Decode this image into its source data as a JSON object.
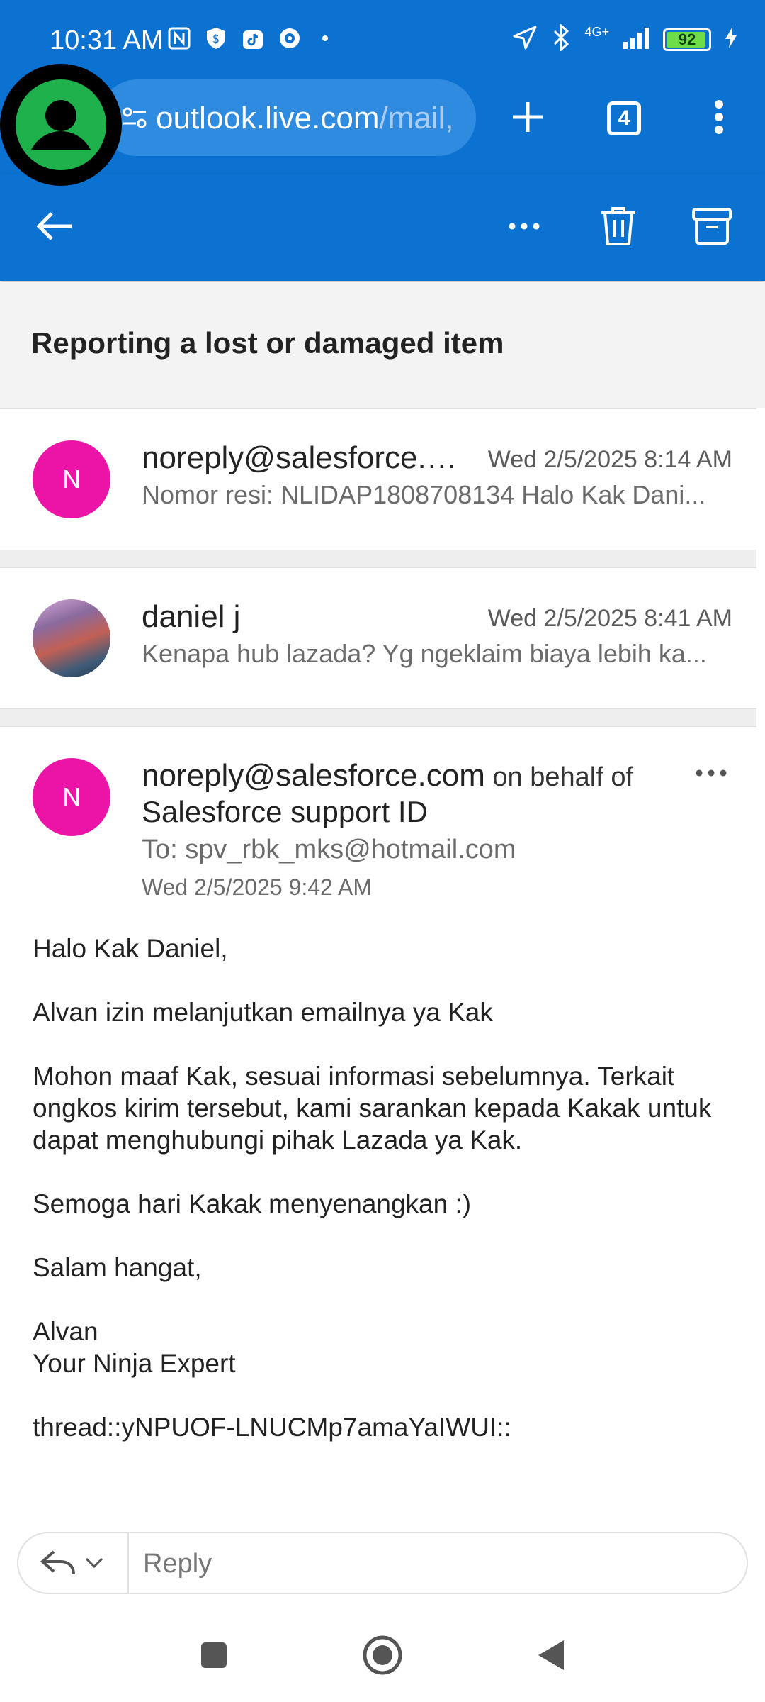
{
  "status_bar": {
    "time": "10:31 AM",
    "network": "4G+",
    "battery": "92",
    "icons": [
      "nfc-icon",
      "shield-dollar-icon",
      "tiktok-icon",
      "circle-app-icon",
      "location-arrow-icon",
      "bluetooth-icon",
      "signal-icon",
      "charging-bolt-icon"
    ]
  },
  "browser": {
    "url_host": "outlook.live.com",
    "url_path": "/mail,",
    "tab_count": "4",
    "icons": [
      "site-settings-icon",
      "new-tab-plus-icon",
      "tab-switcher-icon",
      "browser-menu-icon"
    ]
  },
  "app_bar": {
    "icons": [
      "back-arrow-icon",
      "more-horizontal-icon",
      "delete-trash-icon",
      "archive-icon"
    ]
  },
  "thread": {
    "subject": "Reporting a lost or damaged item",
    "messages": [
      {
        "initial": "N",
        "sender": "noreply@salesforce.c...",
        "date": "Wed 2/5/2025 8:14 AM",
        "preview": "Nomor resi: NLIDAP1808708134 Halo Kak Dani..."
      },
      {
        "initial": "",
        "sender": "daniel j",
        "date": "Wed 2/5/2025 8:41 AM",
        "preview": "Kenapa hub lazada? Yg ngeklaim biaya lebih ka..."
      }
    ],
    "open_message": {
      "initial": "N",
      "sender": "noreply@salesforce.com",
      "behalf": " on behalf of",
      "org": "Salesforce support ID",
      "to": "To: spv_rbk_mks@hotmail.com",
      "date": "Wed 2/5/2025 9:42 AM",
      "body": [
        "Halo Kak Daniel,",
        "Alvan izin melanjutkan emailnya ya Kak",
        "Mohon maaf Kak, sesuai informasi sebelumnya. Terkait ongkos kirim tersebut, kami sarankan kepada Kakak untuk dapat menghubungi pihak Lazada ya Kak.",
        "Semoga hari Kakak menyenangkan :)",
        "Salam hangat,",
        "Alvan\nYour Ninja Expert",
        "thread::yNPUOF-LNUCMp7amaYaIWUI::"
      ]
    }
  },
  "reply": {
    "placeholder": "Reply"
  },
  "colors": {
    "brand_blue": "#0b72d1",
    "avatar_pink": "#ec14a7"
  }
}
